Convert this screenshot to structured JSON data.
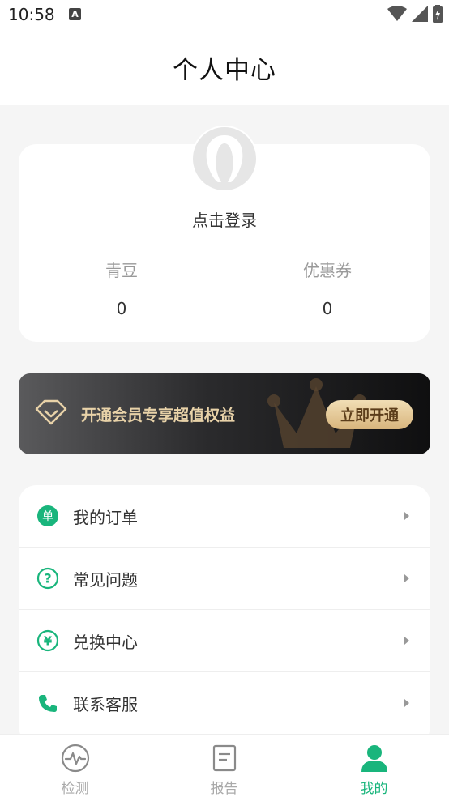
{
  "status_bar": {
    "time": "10:58",
    "notif_letter": "A"
  },
  "header": {
    "title": "个人中心"
  },
  "profile": {
    "login_text": "点击登录",
    "stats": [
      {
        "label": "青豆",
        "value": "0"
      },
      {
        "label": "优惠券",
        "value": "0"
      }
    ]
  },
  "vip": {
    "text": "开通会员专享超值权益",
    "button": "立即开通"
  },
  "menu": {
    "items": [
      {
        "label": "我的订单",
        "icon": "order-icon",
        "icon_text": "单"
      },
      {
        "label": "常见问题",
        "icon": "question-icon",
        "icon_text": "?"
      },
      {
        "label": "兑换中心",
        "icon": "yen-icon",
        "icon_text": "¥"
      },
      {
        "label": "联系客服",
        "icon": "phone-icon"
      }
    ]
  },
  "tabs": [
    {
      "label": "检测",
      "icon": "pulse-icon",
      "active": false
    },
    {
      "label": "报告",
      "icon": "document-icon",
      "active": false
    },
    {
      "label": "我的",
      "icon": "user-icon",
      "active": true
    }
  ],
  "colors": {
    "accent": "#19b57c",
    "vip_gold": "#e8d2a8"
  }
}
